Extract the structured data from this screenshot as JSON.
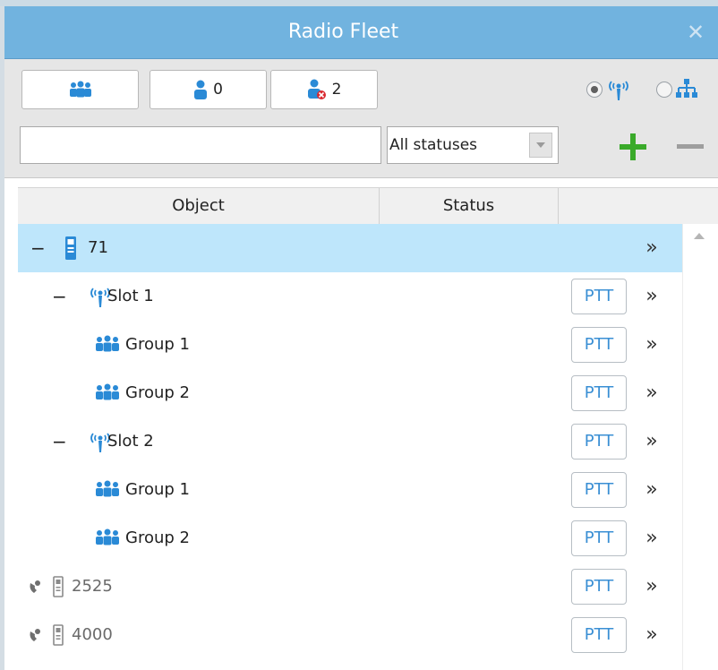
{
  "window": {
    "title": "Radio Fleet",
    "close_glyph": "✕"
  },
  "toolbar": {
    "groups_button": {
      "icon": "group-icon"
    },
    "users_button": {
      "icon": "user-icon",
      "count": "0"
    },
    "offline_button": {
      "icon": "user-offline-icon",
      "count": "2"
    },
    "search": {
      "value": "",
      "placeholder": ""
    },
    "status_filter": {
      "selected": "All statuses"
    },
    "view_mode": {
      "options": [
        "radio-view",
        "tree-view"
      ],
      "selected": "radio-view"
    },
    "add_glyph": "+",
    "remove_glyph": "−"
  },
  "table": {
    "columns": [
      "Object",
      "Status",
      ""
    ],
    "rows": [
      {
        "level": 0,
        "toggle": "−",
        "icon": "radio-device-icon",
        "label": "71",
        "status": "",
        "ptt": "",
        "more": "»",
        "selected": true
      },
      {
        "level": 1,
        "toggle": "−",
        "icon": "antenna-icon",
        "label": "Slot 1",
        "status": "",
        "ptt": "PTT",
        "more": "»",
        "selected": false
      },
      {
        "level": 2,
        "toggle": "",
        "icon": "group-icon",
        "label": "Group 1",
        "status": "",
        "ptt": "PTT",
        "more": "»",
        "selected": false
      },
      {
        "level": 2,
        "toggle": "",
        "icon": "group-icon",
        "label": "Group 2",
        "status": "",
        "ptt": "PTT",
        "more": "»",
        "selected": false
      },
      {
        "level": 1,
        "toggle": "−",
        "icon": "antenna-icon",
        "label": "Slot 2",
        "status": "",
        "ptt": "PTT",
        "more": "»",
        "selected": false
      },
      {
        "level": 2,
        "toggle": "",
        "icon": "group-icon",
        "label": "Group 1",
        "status": "",
        "ptt": "PTT",
        "more": "»",
        "selected": false
      },
      {
        "level": 2,
        "toggle": "",
        "icon": "group-icon",
        "label": "Group 2",
        "status": "",
        "ptt": "PTT",
        "more": "»",
        "selected": false
      },
      {
        "level": 0,
        "toggle": "",
        "icon": "offline-radio-icon",
        "label": "2525",
        "status": "",
        "ptt": "PTT",
        "more": "»",
        "selected": false,
        "dim": true
      },
      {
        "level": 0,
        "toggle": "",
        "icon": "offline-radio-icon",
        "label": "4000",
        "status": "",
        "ptt": "PTT",
        "more": "»",
        "selected": false,
        "dim": true
      }
    ]
  },
  "colors": {
    "title_bar": "#71b3df",
    "selected_row": "#bee6fb",
    "accent_blue": "#2a8ad6",
    "add_green": "#3aaa2a",
    "offline_red": "#d9282f"
  }
}
